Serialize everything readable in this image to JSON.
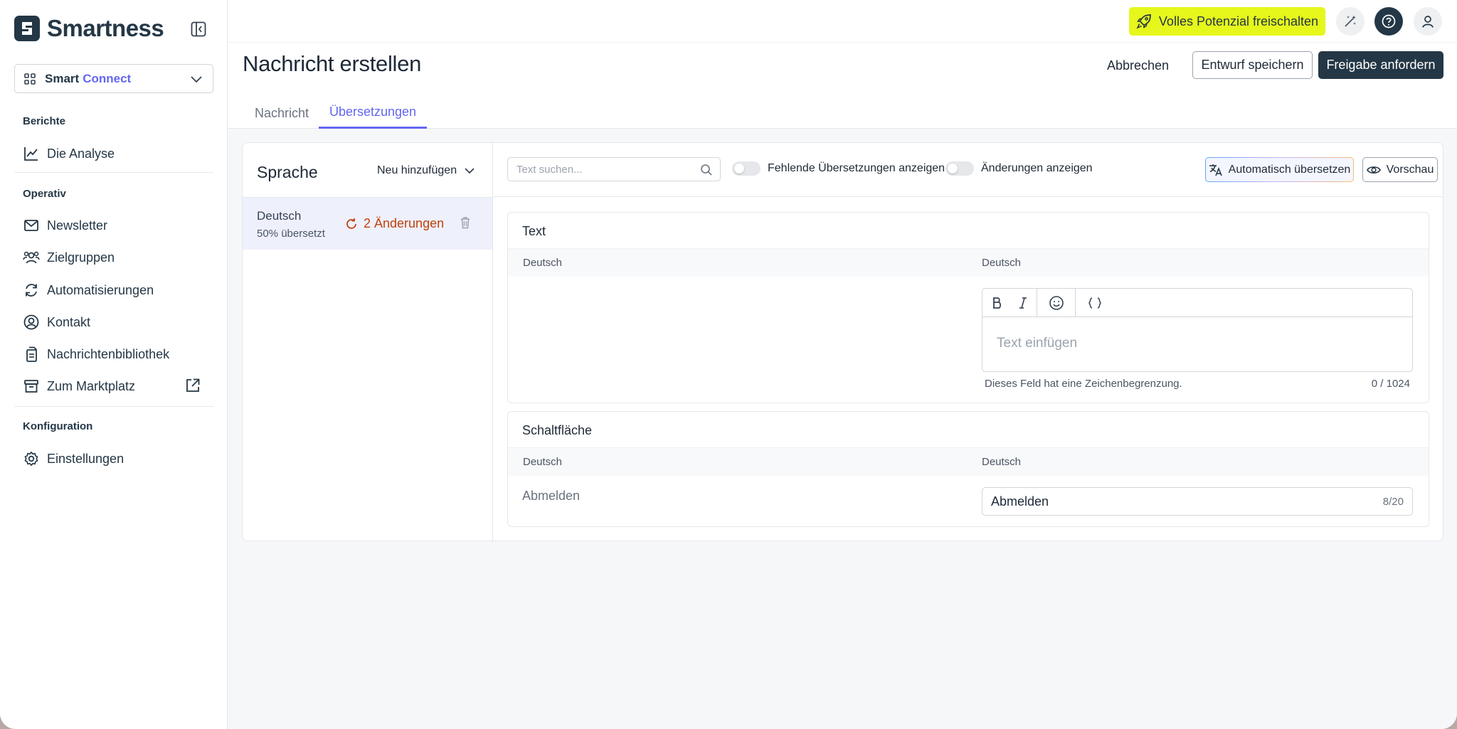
{
  "brand": {
    "name": "Smartness"
  },
  "product_select": {
    "part1": "Smart",
    "part2": "Connect"
  },
  "sidebar": {
    "sections": [
      {
        "label": "Berichte"
      },
      {
        "label": "Operativ"
      },
      {
        "label": "Konfiguration"
      }
    ],
    "items": [
      {
        "label": "Die Analyse",
        "icon": "chart-line-icon"
      },
      {
        "label": "Newsletter",
        "icon": "mail-icon"
      },
      {
        "label": "Zielgruppen",
        "icon": "users-icon"
      },
      {
        "label": "Automatisierungen",
        "icon": "refresh-icon"
      },
      {
        "label": "Kontakt",
        "icon": "user-circle-icon"
      },
      {
        "label": "Nachrichtenbibliothek",
        "icon": "library-icon"
      },
      {
        "label": "Zum Marktplatz",
        "icon": "store-icon"
      },
      {
        "label": "Einstellungen",
        "icon": "gear-icon"
      }
    ]
  },
  "topbar": {
    "upgrade_label": "Volles Potenzial freischalten"
  },
  "page": {
    "title": "Nachricht erstellen",
    "cancel": "Abbrechen",
    "save_draft": "Entwurf speichern",
    "request_approval": "Freigabe anfordern"
  },
  "tabs": [
    {
      "label": "Nachricht",
      "active": false
    },
    {
      "label": "Übersetzungen",
      "active": true
    }
  ],
  "languages": {
    "title": "Sprache",
    "add_label": "Neu hinzufügen",
    "items": [
      {
        "name": "Deutsch",
        "progress": "50% übersetzt",
        "changes": "2 Änderungen"
      }
    ]
  },
  "toolbar": {
    "search_placeholder": "Text suchen...",
    "toggle_missing": "Fehlende Übersetzungen anzeigen",
    "toggle_changes": "Änderungen anzeigen",
    "auto_translate": "Automatisch übersetzen",
    "preview": "Vorschau"
  },
  "sections": {
    "text": {
      "title": "Text",
      "col_source": "Deutsch",
      "col_target": "Deutsch",
      "placeholder": "Text einfügen",
      "hint": "Dieses Feld hat eine Zeichenbegrenzung.",
      "count": "0 / 1024"
    },
    "button": {
      "title": "Schaltfläche",
      "col_source": "Deutsch",
      "col_target": "Deutsch",
      "source_value": "Abmelden",
      "target_value": "Abmelden",
      "count": "8/20"
    }
  },
  "colors": {
    "accent": "#6366f1",
    "brand_dark": "#243746",
    "upgrade_yellow": "#e6f71c",
    "changes_orange": "#c2410c"
  }
}
